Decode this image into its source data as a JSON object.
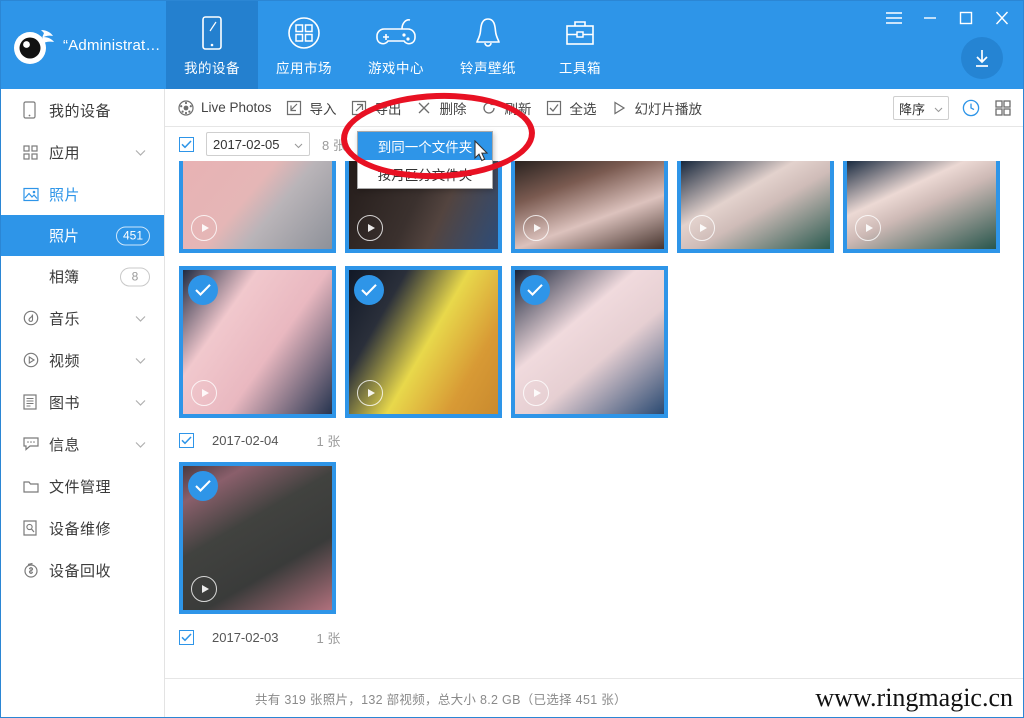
{
  "window": {
    "account": "“Administrat…",
    "controls": [
      {
        "name": "menu",
        "glyph": "≡"
      },
      {
        "name": "minimize",
        "glyph": "–"
      },
      {
        "name": "maximize",
        "glyph": "□"
      },
      {
        "name": "close",
        "glyph": "✕"
      }
    ],
    "download_icon": "download-arrow-icon"
  },
  "nav": {
    "items": [
      {
        "label": "我的设备",
        "icon": "device-icon",
        "active": true
      },
      {
        "label": "应用市场",
        "icon": "apps-grid-icon",
        "active": false
      },
      {
        "label": "游戏中心",
        "icon": "gamepad-icon",
        "active": false
      },
      {
        "label": "铃声壁纸",
        "icon": "bell-icon",
        "active": false
      },
      {
        "label": "工具箱",
        "icon": "toolbox-icon",
        "active": false
      }
    ]
  },
  "sidebar": {
    "items": [
      {
        "label": "我的设备",
        "icon": "phone-icon",
        "chevron": false,
        "selected": false
      },
      {
        "label": "应用",
        "icon": "grid-icon",
        "chevron": true,
        "selected": false
      },
      {
        "label": "照片",
        "icon": "photo-icon",
        "chevron": false,
        "selected": true
      }
    ],
    "sub_items": [
      {
        "label": "照片",
        "badge": "451",
        "active": true
      },
      {
        "label": "相簿",
        "badge": "8",
        "active": false
      }
    ],
    "items_after": [
      {
        "label": "音乐",
        "icon": "music-icon",
        "chevron": true
      },
      {
        "label": "视频",
        "icon": "video-icon",
        "chevron": true
      },
      {
        "label": "图书",
        "icon": "book-icon",
        "chevron": true
      },
      {
        "label": "信息",
        "icon": "message-icon",
        "chevron": true
      },
      {
        "label": "文件管理",
        "icon": "folder-icon",
        "chevron": false
      },
      {
        "label": "设备维修",
        "icon": "repair-icon",
        "chevron": false
      },
      {
        "label": "设备回收",
        "icon": "recycle-money-icon",
        "chevron": false
      }
    ]
  },
  "toolbar": {
    "buttons": [
      {
        "label": "Live Photos",
        "icon": "live-photos-icon"
      },
      {
        "label": "导入",
        "icon": "import-icon"
      },
      {
        "label": "导出",
        "icon": "export-icon"
      },
      {
        "label": "删除",
        "icon": "delete-x-icon"
      },
      {
        "label": "刷新",
        "icon": "refresh-icon"
      },
      {
        "label": "全选",
        "icon": "select-all-checkbox-icon"
      },
      {
        "label": "幻灯片播放",
        "icon": "play-triangle-icon"
      }
    ],
    "sort_value": "降序",
    "time_icon": "clock-icon",
    "grid_icon": "grid-view-icon"
  },
  "export_menu": {
    "items": [
      {
        "label": "到同一个文件夹",
        "highlighted": true
      },
      {
        "label": "按月区分文件夹",
        "highlighted": false
      }
    ]
  },
  "gallery": {
    "groups": [
      {
        "date": "2017-02-05",
        "count": "8 张",
        "has_dropdown": true,
        "checked": true,
        "rows": [
          {
            "clipped_top": true,
            "items": [
              {
                "selected": false,
                "video": true,
                "colors": [
                  "#e9b9bb",
                  "#cfc6c8",
                  "#8b8e96"
                ]
              },
              {
                "selected": false,
                "video": true,
                "colors": [
                  "#241d1a",
                  "#4a3f3c",
                  "#2d4c78"
                ]
              },
              {
                "selected": false,
                "video": true,
                "colors": [
                  "#2a2320",
                  "#d8c0bb",
                  "#6f4b3f"
                ]
              },
              {
                "selected": false,
                "video": true,
                "colors": [
                  "#162436",
                  "#e6d6d2",
                  "#2c5d52"
                ]
              },
              {
                "selected": false,
                "video": true,
                "colors": [
                  "#17263a",
                  "#ecd9d4",
                  "#2b5b50"
                ]
              }
            ]
          },
          {
            "clipped_top": false,
            "items": [
              {
                "selected": true,
                "video": true,
                "colors": [
                  "#19243a",
                  "#f0c8cc",
                  "#2d3f63"
                ]
              },
              {
                "selected": true,
                "video": true,
                "colors": [
                  "#111827",
                  "#e8d84b",
                  "#d8a23a"
                ]
              },
              {
                "selected": true,
                "video": true,
                "colors": [
                  "#17233a",
                  "#efd9dc",
                  "#2b4a72"
                ]
              }
            ]
          }
        ]
      },
      {
        "date": "2017-02-04",
        "count": "1 张",
        "has_dropdown": false,
        "checked": true,
        "rows": [
          {
            "clipped_top": false,
            "items": [
              {
                "selected": true,
                "video": true,
                "colors": [
                  "#3a3a3c",
                  "#a26b74",
                  "#20201f"
                ]
              }
            ]
          }
        ]
      },
      {
        "date": "2017-02-03",
        "count": "1 张",
        "has_dropdown": false,
        "checked": true,
        "rows": []
      }
    ]
  },
  "status": {
    "text": "共有 319 张照片，132 部视频，总大小 8.2 GB（已选择 451 张）",
    "watermark": "www.ringmagic.cn"
  },
  "colors": {
    "brand": "#2e95e8",
    "nav_active": "#2480cf",
    "annotation": "#e81123",
    "selection": "#2e95e8"
  }
}
